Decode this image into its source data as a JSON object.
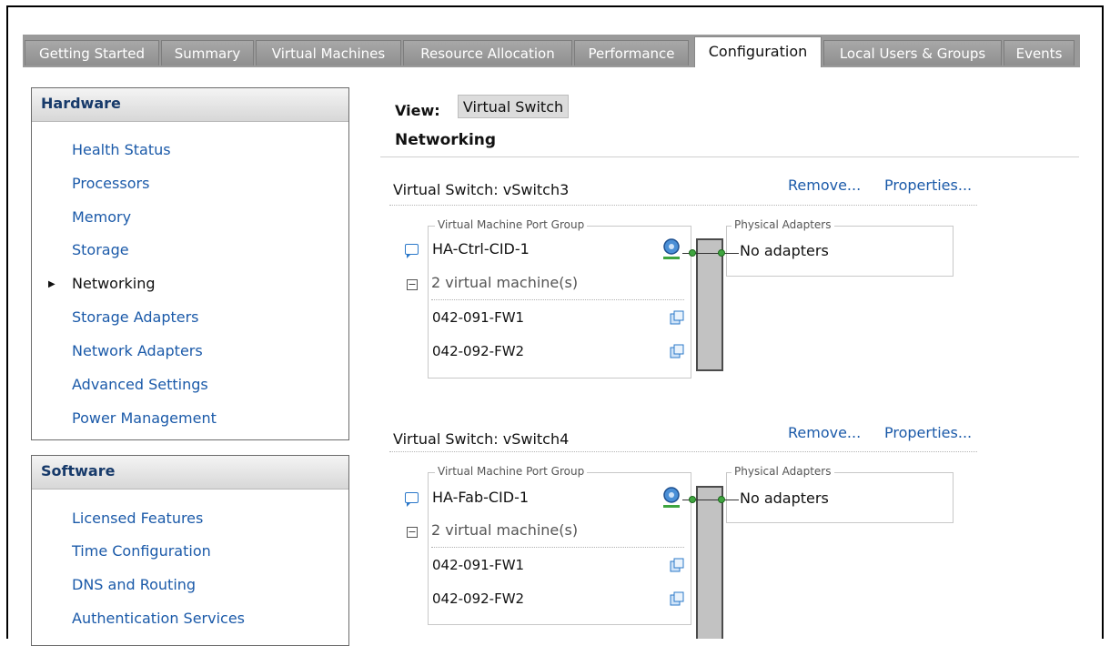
{
  "tabs": [
    {
      "label": "Getting Started"
    },
    {
      "label": "Summary"
    },
    {
      "label": "Virtual Machines"
    },
    {
      "label": "Resource Allocation"
    },
    {
      "label": "Performance"
    },
    {
      "label": "Configuration"
    },
    {
      "label": "Local Users & Groups"
    },
    {
      "label": "Events"
    }
  ],
  "active_tab": "Configuration",
  "hardware": {
    "title": "Hardware",
    "items": [
      {
        "label": "Health Status"
      },
      {
        "label": "Processors"
      },
      {
        "label": "Memory"
      },
      {
        "label": "Storage"
      },
      {
        "label": "Networking"
      },
      {
        "label": "Storage Adapters"
      },
      {
        "label": "Network Adapters"
      },
      {
        "label": "Advanced Settings"
      },
      {
        "label": "Power Management"
      }
    ],
    "selected": "Networking"
  },
  "software": {
    "title": "Software",
    "items": [
      {
        "label": "Licensed Features"
      },
      {
        "label": "Time Configuration"
      },
      {
        "label": "DNS and Routing"
      },
      {
        "label": "Authentication Services"
      }
    ]
  },
  "view": {
    "label": "View:",
    "value": "Virtual Switch"
  },
  "section_title": "Networking",
  "switches": [
    {
      "title": "Virtual Switch: vSwitch3",
      "remove": "Remove...",
      "properties": "Properties...",
      "port_group_legend": "Virtual Machine Port Group",
      "port_group": "HA-Ctrl-CID-1",
      "vm_count": "2 virtual machine(s)",
      "vms": [
        "042-091-FW1",
        "042-092-FW2"
      ],
      "physical_legend": "Physical Adapters",
      "physical_value": "No adapters"
    },
    {
      "title": "Virtual Switch: vSwitch4",
      "remove": "Remove...",
      "properties": "Properties...",
      "port_group_legend": "Virtual Machine Port Group",
      "port_group": "HA-Fab-CID-1",
      "vm_count": "2 virtual machine(s)",
      "vms": [
        "042-091-FW1",
        "042-092-FW2"
      ],
      "physical_legend": "Physical Adapters",
      "physical_value": "No adapters"
    }
  ],
  "colors": {
    "link": "#1b5aa9",
    "tabbar": "#9a9a9a",
    "connector": "#3fa53f"
  }
}
